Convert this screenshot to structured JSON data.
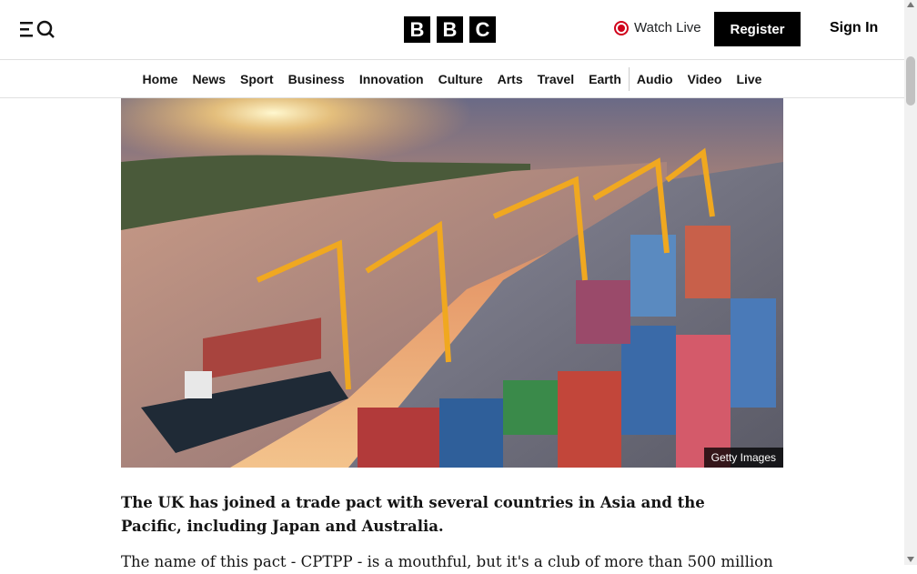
{
  "header": {
    "menu_icon": "menu-search-icon",
    "logo_letters": [
      "B",
      "B",
      "C"
    ],
    "watch_live_label": "Watch Live",
    "register_label": "Register",
    "signin_label": "Sign In",
    "accent_color": "#d0021b"
  },
  "nav": {
    "items": [
      "Home",
      "News",
      "Sport",
      "Business",
      "Innovation",
      "Culture",
      "Arts",
      "Travel",
      "Earth",
      "Audio",
      "Video",
      "Live"
    ]
  },
  "article": {
    "image_credit": "Getty Images",
    "lead": "The UK has joined a trade pact with several countries in Asia and the Pacific, including Japan and Australia.",
    "body": "The name of this pact - CPTPP - is a mouthful, but it's a club of more than 500 million"
  }
}
